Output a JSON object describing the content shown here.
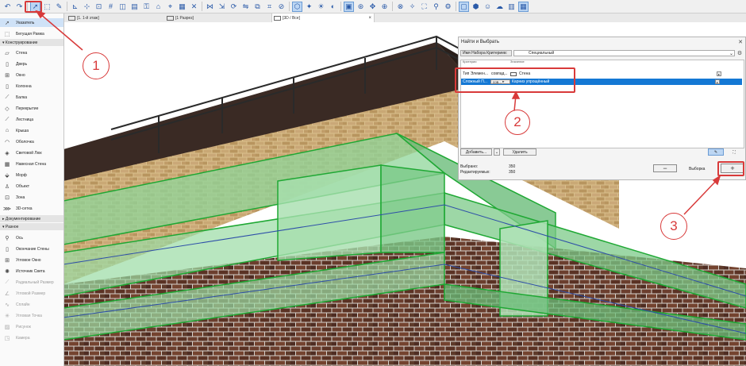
{
  "toolbar": {
    "icons": [
      "undo-icon",
      "redo-icon",
      "arrow-select-icon",
      "marquee-icon",
      "magic-wand-icon",
      "eyedropper-icon",
      "snap-guides-icon",
      "grid-icon",
      "layers-icon",
      "plan-icon",
      "section-icon",
      "elevation-icon",
      "3d-icon",
      "render-icon",
      "sun-icon",
      "walk-icon",
      "favorites-icon",
      "window-icon"
    ]
  },
  "tabs": [
    {
      "label": "[1. 1-й этаж]"
    },
    {
      "label": "[1 Разрез]"
    },
    {
      "label": "[3D / Все]",
      "active": true
    }
  ],
  "sidebar": {
    "top_items": [
      {
        "label": "Указатель",
        "icon": "arrow-pointer-icon",
        "selected": true
      },
      {
        "label": "Бегущая Рамка",
        "icon": "marquee-icon"
      }
    ],
    "section_construct": "Конструирование",
    "construct_items": [
      {
        "label": "Стена",
        "icon": "wall-icon"
      },
      {
        "label": "Дверь",
        "icon": "door-icon"
      },
      {
        "label": "Окно",
        "icon": "window-icon"
      },
      {
        "label": "Колонна",
        "icon": "column-icon"
      },
      {
        "label": "Балка",
        "icon": "beam-icon"
      },
      {
        "label": "Перекрытие",
        "icon": "slab-icon"
      },
      {
        "label": "Лестница",
        "icon": "stair-icon"
      },
      {
        "label": "Крыша",
        "icon": "roof-icon"
      },
      {
        "label": "Оболочка",
        "icon": "shell-icon"
      },
      {
        "label": "Световой Люк",
        "icon": "skylight-icon"
      },
      {
        "label": "Навесная Стена",
        "icon": "curtain-wall-icon"
      },
      {
        "label": "Морф",
        "icon": "morph-icon"
      },
      {
        "label": "Объект",
        "icon": "object-icon"
      },
      {
        "label": "Зона",
        "icon": "zone-icon"
      },
      {
        "label": "3D-сетка",
        "icon": "mesh-icon"
      }
    ],
    "section_document": "Документирование",
    "section_misc": "Разное",
    "misc_items": [
      {
        "label": "Ось",
        "icon": "axis-icon"
      },
      {
        "label": "Окончание Стены",
        "icon": "wall-end-icon"
      },
      {
        "label": "Угловое Окно",
        "icon": "corner-window-icon"
      },
      {
        "label": "Источник Света",
        "icon": "light-icon"
      },
      {
        "label": "Радиальный Размер",
        "icon": "radial-dimension-icon",
        "disabled": true
      },
      {
        "label": "Угловой Размер",
        "icon": "angle-dimension-icon",
        "disabled": true
      },
      {
        "label": "Сплайн",
        "icon": "spline-icon",
        "disabled": true
      },
      {
        "label": "Угловая Точка",
        "icon": "hotspot-icon",
        "disabled": true
      },
      {
        "label": "Рисунок",
        "icon": "figure-icon",
        "disabled": true
      },
      {
        "label": "Камера",
        "icon": "camera-icon",
        "disabled": true
      }
    ]
  },
  "panel": {
    "title": "Найти и Выбрать",
    "criteria_set_label": "Имя Набора Критериев:",
    "criteria_set_value": "Специальный",
    "list_head_col1": "Критерии",
    "list_head_col2": "Значение",
    "rows": [
      {
        "criterion": "Тип Элемен...",
        "op": "совпад...",
        "value": "Стена"
      },
      {
        "criterion": "Сложный П...",
        "op": "сов...",
        "value": "Карниз упрощённый"
      }
    ],
    "add_button": "Добавить...",
    "delete_button": "Удалить",
    "selected_label": "Выбрано:",
    "selected_count": "350",
    "editable_label": "Редактируемых:",
    "editable_count": "350",
    "minus_button": "−",
    "selection_label": "Выборка",
    "plus_button": "+"
  },
  "callouts": [
    "1",
    "2",
    "3"
  ],
  "colors": {
    "accent": "#1478d4",
    "callout": "#d83a3a",
    "brick_light": "#c9a875",
    "brick_dark": "#5e3a2a",
    "glass_green": "#7ecf8a"
  }
}
